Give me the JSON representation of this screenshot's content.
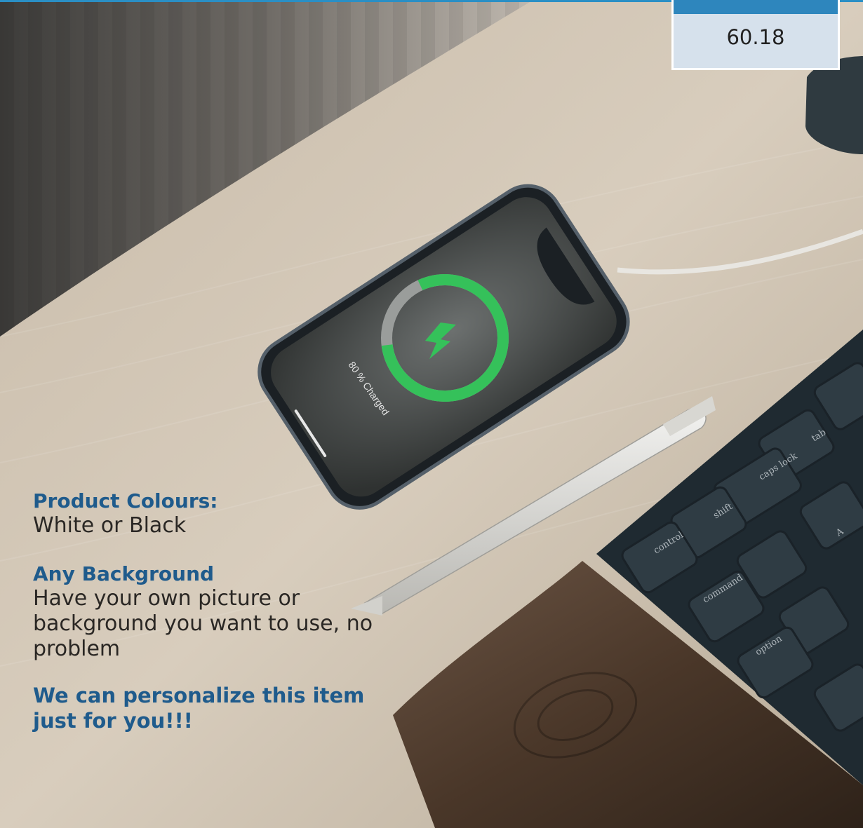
{
  "price": {
    "value": "60.18"
  },
  "phone": {
    "charge_label": "80 % Charged",
    "charge_percent": 80
  },
  "copy": {
    "colours_heading": "Product Colours:",
    "colours_text": "White or Black",
    "background_heading": "Any Background",
    "background_text": "Have your own picture or background you want to use, no problem",
    "personalize_heading": "We can personalize this item just for you!!!"
  },
  "keyboard": {
    "keys": [
      "tab",
      "caps lock",
      "shift",
      "control",
      "command",
      "option",
      "A"
    ]
  },
  "colors": {
    "accent": "#2a8fc5",
    "heading": "#1f5b8c",
    "charge": "#35c15a"
  }
}
